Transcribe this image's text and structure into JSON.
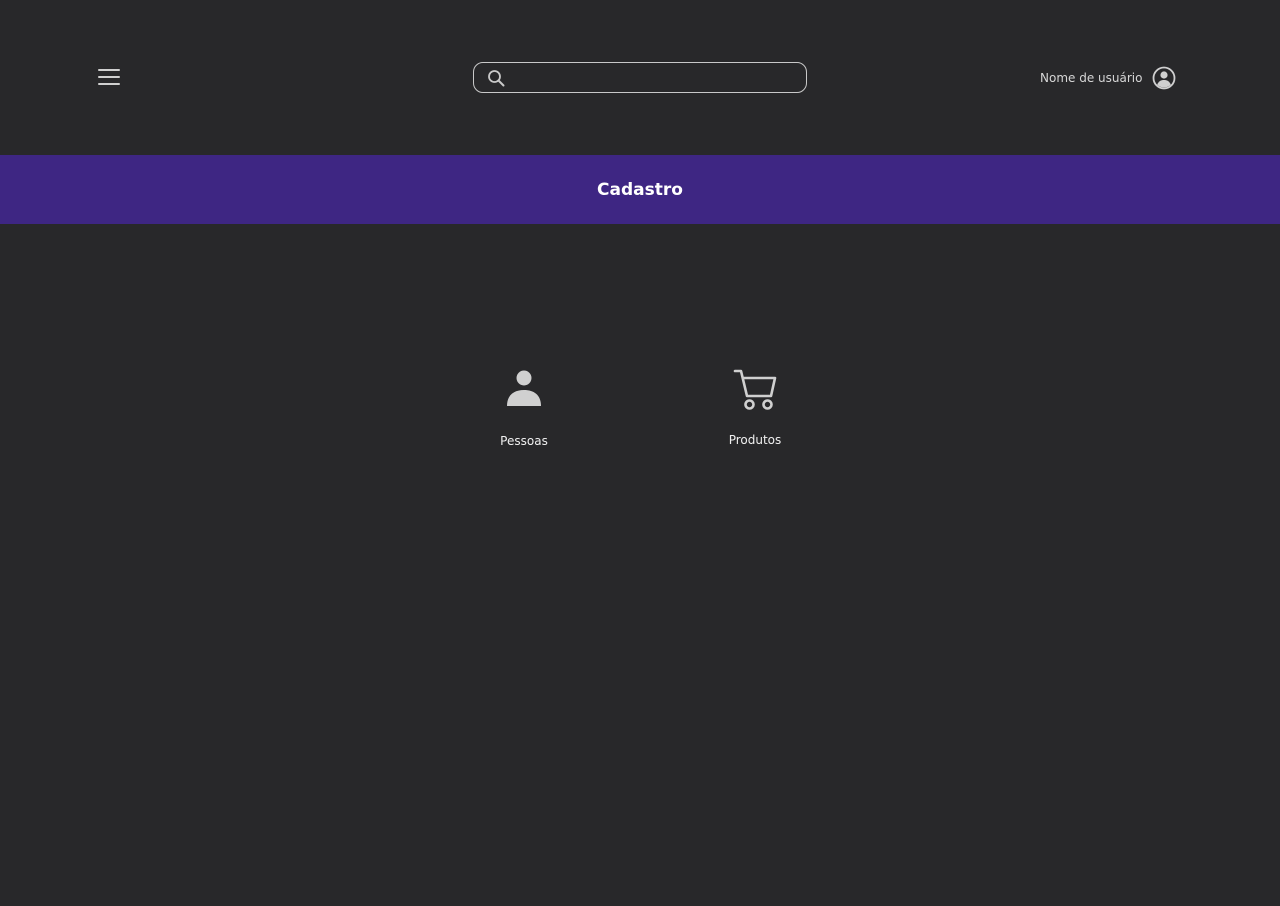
{
  "header": {
    "menu_icon": "hamburger-menu-icon",
    "search": {
      "placeholder": "",
      "value": "",
      "icon": "search-icon"
    },
    "user": {
      "name": "Nome de usuário",
      "icon": "user-circle-icon"
    }
  },
  "banner": {
    "title": "Cadastro",
    "color": "#3e2683"
  },
  "tiles": [
    {
      "label": "Pessoas",
      "icon": "person-icon"
    },
    {
      "label": "Produtos",
      "icon": "shopping-cart-icon"
    }
  ],
  "colors": {
    "background": "#28282a",
    "icon": "#d0d0d0",
    "text": "#f0f0f0"
  }
}
